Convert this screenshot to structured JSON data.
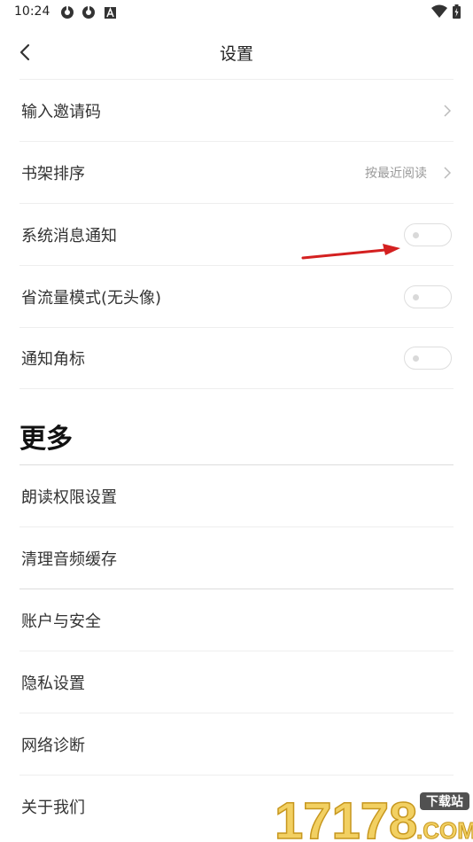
{
  "status_bar": {
    "time": "10:24",
    "icons": [
      "sync-icon",
      "sync-icon",
      "font-icon",
      "wifi-icon",
      "battery-icon"
    ]
  },
  "header": {
    "title": "设置",
    "back_icon": "chevron-left-icon"
  },
  "settings": [
    {
      "label": "输入邀请码",
      "type": "link"
    },
    {
      "label": "书架排序",
      "type": "link",
      "value": "按最近阅读"
    },
    {
      "label": "系统消息通知",
      "type": "toggle",
      "on": false
    },
    {
      "label": "省流量模式(无头像)",
      "type": "toggle",
      "on": false
    },
    {
      "label": "通知角标",
      "type": "toggle",
      "on": false
    }
  ],
  "more": {
    "title": "更多",
    "items": [
      {
        "label": "朗读权限设置"
      },
      {
        "label": "清理音频缓存"
      },
      {
        "label": "账户与安全"
      },
      {
        "label": "隐私设置"
      },
      {
        "label": "网络诊断"
      },
      {
        "label": "关于我们"
      }
    ]
  },
  "watermark": {
    "number": "17178",
    "tag": "下载站",
    "suffix": ".COM"
  },
  "colors": {
    "arrow": "#d42020",
    "divider": "#eeeeee",
    "watermark": "#f0c846"
  }
}
